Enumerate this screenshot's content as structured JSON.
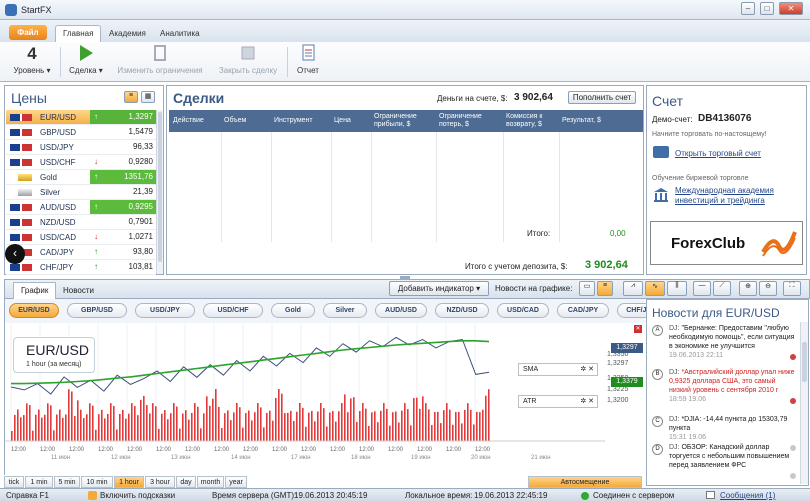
{
  "window": {
    "title": "StartFX"
  },
  "ribbon_tabs": {
    "file": "Файл",
    "main": "Главная",
    "academy": "Академия",
    "analytics": "Аналитика"
  },
  "ribbon": {
    "level_value": "4",
    "level_label": "Уровень ▾",
    "trade_label": "Сделка ▾",
    "change_limits": "Изменить ограничения",
    "close_deal": "Закрыть сделку",
    "report": "Отчет"
  },
  "prices": {
    "title": "Цены",
    "rows": [
      {
        "symbol": "EUR/USD",
        "value": "1,3297",
        "dir": "up",
        "highlight": "selected"
      },
      {
        "symbol": "GBP/USD",
        "value": "1,5479",
        "dir": "",
        "highlight": ""
      },
      {
        "symbol": "USD/JPY",
        "value": "96,33",
        "dir": "",
        "highlight": ""
      },
      {
        "symbol": "USD/CHF",
        "value": "0,9280",
        "dir": "down",
        "highlight": ""
      },
      {
        "symbol": "Gold",
        "value": "1351,76",
        "dir": "up",
        "highlight": "green"
      },
      {
        "symbol": "Silver",
        "value": "21,39",
        "dir": "",
        "highlight": ""
      },
      {
        "symbol": "AUD/USD",
        "value": "0,9295",
        "dir": "up",
        "highlight": "green"
      },
      {
        "symbol": "NZD/USD",
        "value": "0,7901",
        "dir": "",
        "highlight": ""
      },
      {
        "symbol": "USD/CAD",
        "value": "1,0271",
        "dir": "down",
        "highlight": ""
      },
      {
        "symbol": "CAD/JPY",
        "value": "93,80",
        "dir": "up",
        "highlight": ""
      },
      {
        "symbol": "CHF/JPY",
        "value": "103,81",
        "dir": "up",
        "highlight": ""
      }
    ]
  },
  "deals": {
    "title": "Сделки",
    "balance_label": "Деньги на счете, $:",
    "balance_value": "3 902,64",
    "topup_button": "Пополнить счет",
    "columns": [
      "Действие",
      "Объем",
      "Инструмент",
      "Цена",
      "Ограничение прибыли, $",
      "Ограничение потерь, $",
      "Комиссия к возврату, $",
      "Результат, $"
    ],
    "total_label": "Итого:",
    "total_value": "0,00",
    "total_with_deposit_label": "Итого с учетом депозита, $:",
    "total_with_deposit_value": "3 902,64"
  },
  "account": {
    "title": "Счет",
    "demo_label": "Демо-счет:",
    "demo_id": "DB4136076",
    "start_text": "Начните торговать по-настоящему!",
    "open_link": "Открыть торговый счет",
    "learn_text": "Обучение биржевой торговле",
    "academy_link": "Международная академия инвестиций и трейдинга",
    "logo_text": "ForexClub"
  },
  "bottom_tabs": {
    "chart": "График",
    "news": "Новости"
  },
  "chart_toolbar": {
    "add_indicator": "Добавить индикатор",
    "news_on_chart": "Новости на графике:"
  },
  "symbols": [
    "EUR/USD",
    "GBP/USD",
    "USD/JPY",
    "USD/CHF",
    "Gold",
    "Silver",
    "AUD/USD",
    "NZD/USD",
    "USD/CAD",
    "CAD/JPY",
    "CHF/JPY"
  ],
  "chart_data": {
    "type": "line",
    "title": "EUR/USD",
    "subtitle": "1 hour (за месяц)",
    "ylim": [
      1.32,
      1.34
    ],
    "y_ticks": [
      "1,3379",
      "1,3350",
      "1,3297",
      "1,3250",
      "1,3225",
      "1,3200"
    ],
    "x_labels": [
      "12:00",
      "12:00",
      "12:00",
      "12:00",
      "12:00",
      "12:00",
      "12:00",
      "12:00",
      "12:00",
      "12:00",
      "12:00",
      "12:00",
      "12:00",
      "12:00",
      "12:00",
      "12:00",
      "12:00"
    ],
    "x_dates": [
      "11 июн",
      "12 июн",
      "13 июн",
      "14 июн",
      "17 июн",
      "18 июн",
      "19 июн",
      "20 июн",
      "21 июн"
    ],
    "series": [
      {
        "name": "EUR/USD",
        "values": [
          1.3262,
          1.3255,
          1.327,
          1.3245,
          1.3286,
          1.3261,
          1.3278,
          1.3252,
          1.329,
          1.3268,
          1.3282,
          1.33,
          1.3275,
          1.331,
          1.3285,
          1.3315,
          1.329,
          1.3325,
          1.33,
          1.3335,
          1.3312,
          1.3342,
          1.332,
          1.3355,
          1.3335,
          1.3365,
          1.3345,
          1.3372,
          1.3358,
          1.338,
          1.3362,
          1.3375,
          1.3355,
          1.337,
          1.3375,
          1.3292,
          1.3297
        ]
      },
      {
        "name": "SMA",
        "values": [
          1.327,
          1.327,
          1.3271,
          1.3272,
          1.3273,
          1.3275,
          1.3277,
          1.328,
          1.3283,
          1.3286,
          1.329,
          1.3294,
          1.3298,
          1.3302,
          1.3306,
          1.331,
          1.3314,
          1.3318,
          1.3322,
          1.3326,
          1.333,
          1.3334,
          1.3338,
          1.3342,
          1.3346,
          1.335,
          1.3353,
          1.3356,
          1.3359,
          1.3362,
          1.3364,
          1.3366,
          1.3368,
          1.337,
          1.3372,
          1.3372,
          1.337
        ]
      }
    ],
    "sma_label": "SMA",
    "atr_label": "ATR",
    "price_tag_1": "1,3379",
    "price_tag_2": "1,3297"
  },
  "timeframes": [
    "tick",
    "1 min",
    "5 min",
    "10 min",
    "1 hour",
    "3 hour",
    "day",
    "month",
    "year"
  ],
  "auto_shift": "Автосмещение",
  "news": {
    "title": "Новости для EUR/USD",
    "items": [
      {
        "source": "DJ:",
        "text": "\"Бернанке: Предоставим \"любую необходимую помощь\", если ситуация в экономике не улучшится",
        "time": "19.06.2013 22:11",
        "color": "#1a1a1a",
        "dot": "#d04040"
      },
      {
        "source": "DJ:",
        "text": "*Австралийский доллар упал ниже 0,9325 доллара США, это самый низкий уровень с сентября 2010 г",
        "time": "18:59 19.06",
        "color": "#d02020",
        "dot": "#d04040"
      },
      {
        "source": "DJ:",
        "text": "*DJIA: -14,44 пункта до 15303,79 пункта",
        "time": "15:31 19.06",
        "color": "#1a1a1a",
        "dot": "#c9c9c9"
      },
      {
        "source": "DJ:",
        "text": "ОБЗОР: Канадский доллар торгуется с небольшим повышением перед заявлением ФРС",
        "time": "",
        "color": "#1a1a1a",
        "dot": "#c9c9c9"
      }
    ]
  },
  "statusbar": {
    "help": "Справка F1",
    "hints": "Включить подсказки",
    "server_time_label": "Время сервера (GMT):",
    "server_time": "19.06.2013 20:45:19",
    "local_time_label": "Локальное время:",
    "local_time": "19.06.2013 22:45:19",
    "connected": "Соединен с сервером",
    "messages": "Сообщения (1)"
  }
}
